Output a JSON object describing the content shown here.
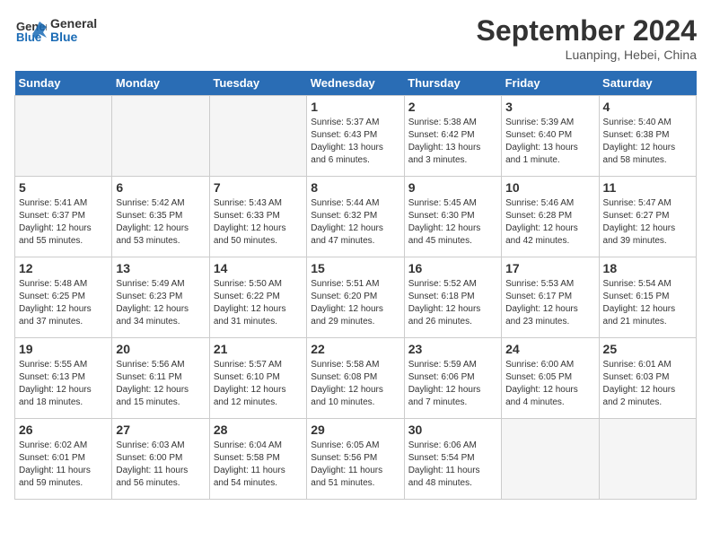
{
  "header": {
    "logo_line1": "General",
    "logo_line2": "Blue",
    "month_title": "September 2024",
    "location": "Luanping, Hebei, China"
  },
  "weekdays": [
    "Sunday",
    "Monday",
    "Tuesday",
    "Wednesday",
    "Thursday",
    "Friday",
    "Saturday"
  ],
  "days": [
    {
      "num": "",
      "info": ""
    },
    {
      "num": "",
      "info": ""
    },
    {
      "num": "",
      "info": ""
    },
    {
      "num": "1",
      "info": "Sunrise: 5:37 AM\nSunset: 6:43 PM\nDaylight: 13 hours\nand 6 minutes."
    },
    {
      "num": "2",
      "info": "Sunrise: 5:38 AM\nSunset: 6:42 PM\nDaylight: 13 hours\nand 3 minutes."
    },
    {
      "num": "3",
      "info": "Sunrise: 5:39 AM\nSunset: 6:40 PM\nDaylight: 13 hours\nand 1 minute."
    },
    {
      "num": "4",
      "info": "Sunrise: 5:40 AM\nSunset: 6:38 PM\nDaylight: 12 hours\nand 58 minutes."
    },
    {
      "num": "5",
      "info": "Sunrise: 5:41 AM\nSunset: 6:37 PM\nDaylight: 12 hours\nand 55 minutes."
    },
    {
      "num": "6",
      "info": "Sunrise: 5:42 AM\nSunset: 6:35 PM\nDaylight: 12 hours\nand 53 minutes."
    },
    {
      "num": "7",
      "info": "Sunrise: 5:43 AM\nSunset: 6:33 PM\nDaylight: 12 hours\nand 50 minutes."
    },
    {
      "num": "8",
      "info": "Sunrise: 5:44 AM\nSunset: 6:32 PM\nDaylight: 12 hours\nand 47 minutes."
    },
    {
      "num": "9",
      "info": "Sunrise: 5:45 AM\nSunset: 6:30 PM\nDaylight: 12 hours\nand 45 minutes."
    },
    {
      "num": "10",
      "info": "Sunrise: 5:46 AM\nSunset: 6:28 PM\nDaylight: 12 hours\nand 42 minutes."
    },
    {
      "num": "11",
      "info": "Sunrise: 5:47 AM\nSunset: 6:27 PM\nDaylight: 12 hours\nand 39 minutes."
    },
    {
      "num": "12",
      "info": "Sunrise: 5:48 AM\nSunset: 6:25 PM\nDaylight: 12 hours\nand 37 minutes."
    },
    {
      "num": "13",
      "info": "Sunrise: 5:49 AM\nSunset: 6:23 PM\nDaylight: 12 hours\nand 34 minutes."
    },
    {
      "num": "14",
      "info": "Sunrise: 5:50 AM\nSunset: 6:22 PM\nDaylight: 12 hours\nand 31 minutes."
    },
    {
      "num": "15",
      "info": "Sunrise: 5:51 AM\nSunset: 6:20 PM\nDaylight: 12 hours\nand 29 minutes."
    },
    {
      "num": "16",
      "info": "Sunrise: 5:52 AM\nSunset: 6:18 PM\nDaylight: 12 hours\nand 26 minutes."
    },
    {
      "num": "17",
      "info": "Sunrise: 5:53 AM\nSunset: 6:17 PM\nDaylight: 12 hours\nand 23 minutes."
    },
    {
      "num": "18",
      "info": "Sunrise: 5:54 AM\nSunset: 6:15 PM\nDaylight: 12 hours\nand 21 minutes."
    },
    {
      "num": "19",
      "info": "Sunrise: 5:55 AM\nSunset: 6:13 PM\nDaylight: 12 hours\nand 18 minutes."
    },
    {
      "num": "20",
      "info": "Sunrise: 5:56 AM\nSunset: 6:11 PM\nDaylight: 12 hours\nand 15 minutes."
    },
    {
      "num": "21",
      "info": "Sunrise: 5:57 AM\nSunset: 6:10 PM\nDaylight: 12 hours\nand 12 minutes."
    },
    {
      "num": "22",
      "info": "Sunrise: 5:58 AM\nSunset: 6:08 PM\nDaylight: 12 hours\nand 10 minutes."
    },
    {
      "num": "23",
      "info": "Sunrise: 5:59 AM\nSunset: 6:06 PM\nDaylight: 12 hours\nand 7 minutes."
    },
    {
      "num": "24",
      "info": "Sunrise: 6:00 AM\nSunset: 6:05 PM\nDaylight: 12 hours\nand 4 minutes."
    },
    {
      "num": "25",
      "info": "Sunrise: 6:01 AM\nSunset: 6:03 PM\nDaylight: 12 hours\nand 2 minutes."
    },
    {
      "num": "26",
      "info": "Sunrise: 6:02 AM\nSunset: 6:01 PM\nDaylight: 11 hours\nand 59 minutes."
    },
    {
      "num": "27",
      "info": "Sunrise: 6:03 AM\nSunset: 6:00 PM\nDaylight: 11 hours\nand 56 minutes."
    },
    {
      "num": "28",
      "info": "Sunrise: 6:04 AM\nSunset: 5:58 PM\nDaylight: 11 hours\nand 54 minutes."
    },
    {
      "num": "29",
      "info": "Sunrise: 6:05 AM\nSunset: 5:56 PM\nDaylight: 11 hours\nand 51 minutes."
    },
    {
      "num": "30",
      "info": "Sunrise: 6:06 AM\nSunset: 5:54 PM\nDaylight: 11 hours\nand 48 minutes."
    },
    {
      "num": "",
      "info": ""
    },
    {
      "num": "",
      "info": ""
    },
    {
      "num": "",
      "info": ""
    },
    {
      "num": "",
      "info": ""
    },
    {
      "num": "",
      "info": ""
    }
  ]
}
